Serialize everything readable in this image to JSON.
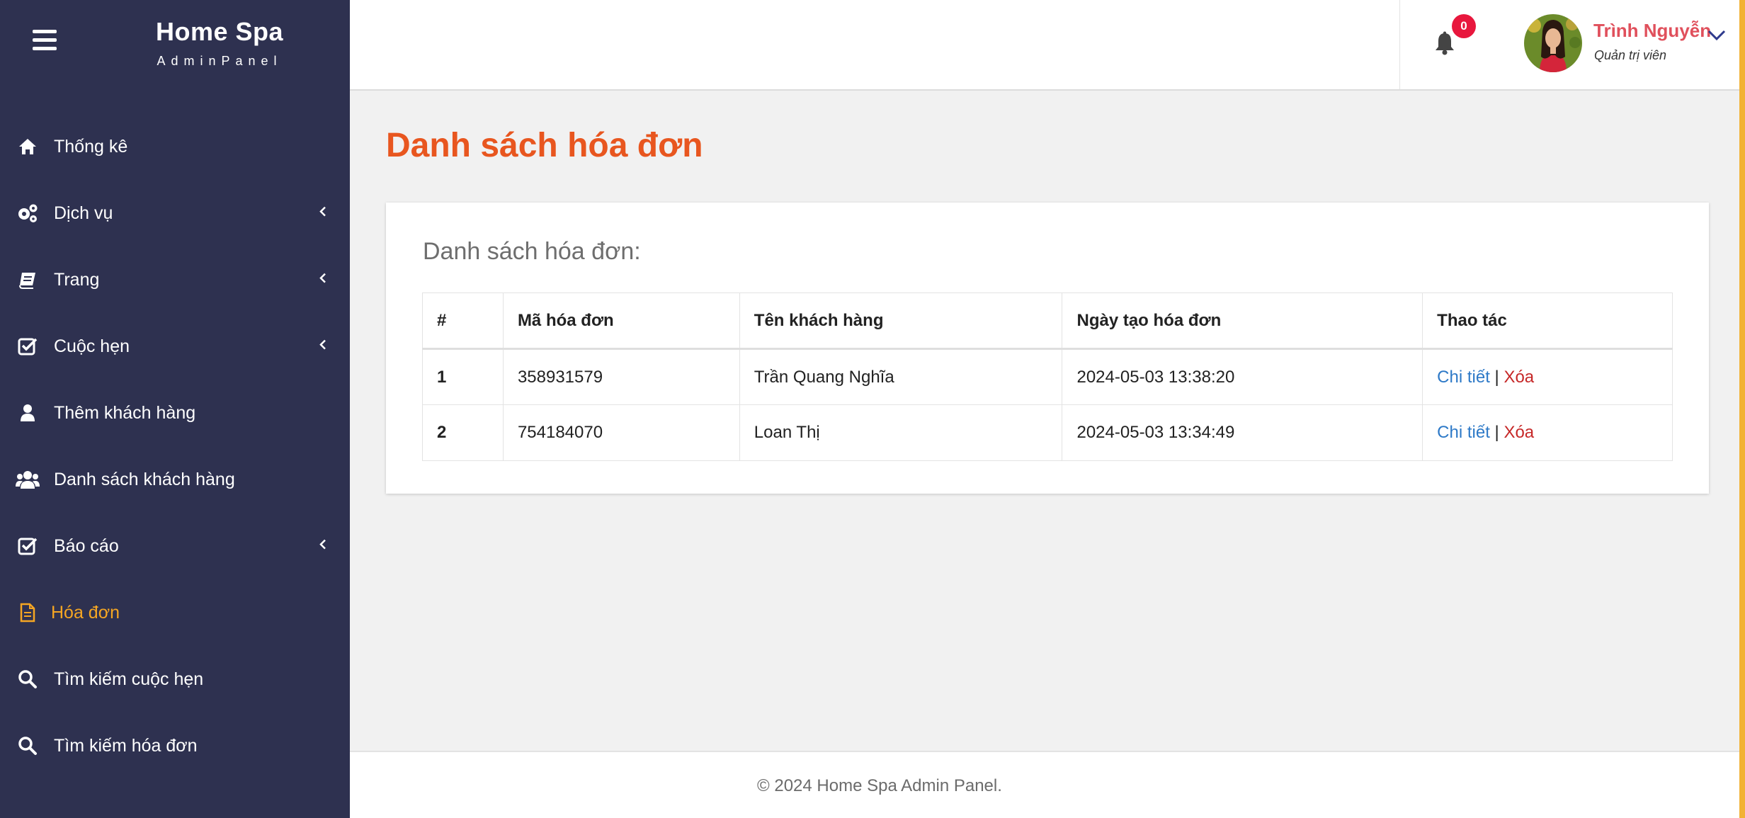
{
  "brand": {
    "title": "Home Spa",
    "subtitle": "AdminPanel"
  },
  "sidebar": {
    "items": [
      {
        "label": "Thống kê",
        "icon": "home-icon",
        "has_submenu": false
      },
      {
        "label": "Dịch vụ",
        "icon": "gears-icon",
        "has_submenu": true
      },
      {
        "label": "Trang",
        "icon": "book-icon",
        "has_submenu": true
      },
      {
        "label": "Cuộc hẹn",
        "icon": "check-square-icon",
        "has_submenu": true
      },
      {
        "label": "Thêm khách hàng",
        "icon": "user-icon",
        "has_submenu": false
      },
      {
        "label": "Danh sách khách hàng",
        "icon": "users-icon",
        "has_submenu": false
      },
      {
        "label": "Báo cáo",
        "icon": "check-square-icon",
        "has_submenu": true
      },
      {
        "label": "Hóa đơn",
        "icon": "file-icon",
        "has_submenu": false,
        "active": true
      },
      {
        "label": "Tìm kiếm cuộc hẹn",
        "icon": "search-icon",
        "has_submenu": false
      },
      {
        "label": "Tìm kiếm hóa đơn",
        "icon": "search-icon",
        "has_submenu": false
      }
    ]
  },
  "topbar": {
    "notification_count": "0",
    "user_name": "Trình Nguyễn",
    "user_role": "Quản trị viên"
  },
  "page": {
    "title": "Danh sách hóa đơn"
  },
  "card": {
    "title": "Danh sách hóa đơn:"
  },
  "table": {
    "headers": [
      "#",
      "Mã hóa đơn",
      "Tên khách hàng",
      "Ngày tạo hóa đơn",
      "Thao tác"
    ],
    "rows": [
      {
        "index": "1",
        "code": "358931579",
        "customer": "Trần Quang Nghĩa",
        "created": "2024-05-03 13:38:20",
        "detail": "Chi tiết",
        "separator": "|",
        "delete": "Xóa"
      },
      {
        "index": "2",
        "code": "754184070",
        "customer": "Loan Thị",
        "created": "2024-05-03 13:34:49",
        "detail": "Chi tiết",
        "separator": "|",
        "delete": "Xóa"
      }
    ]
  },
  "footer": {
    "text": "© 2024 Home Spa Admin Panel."
  },
  "colors": {
    "sidebar_bg": "#2e3150",
    "active_nav": "#f5a623",
    "title_accent": "#e8561f",
    "badge": "#e8173d",
    "user_name": "#e0505c",
    "link": "#2d79c7",
    "delete_link": "#c62828"
  }
}
